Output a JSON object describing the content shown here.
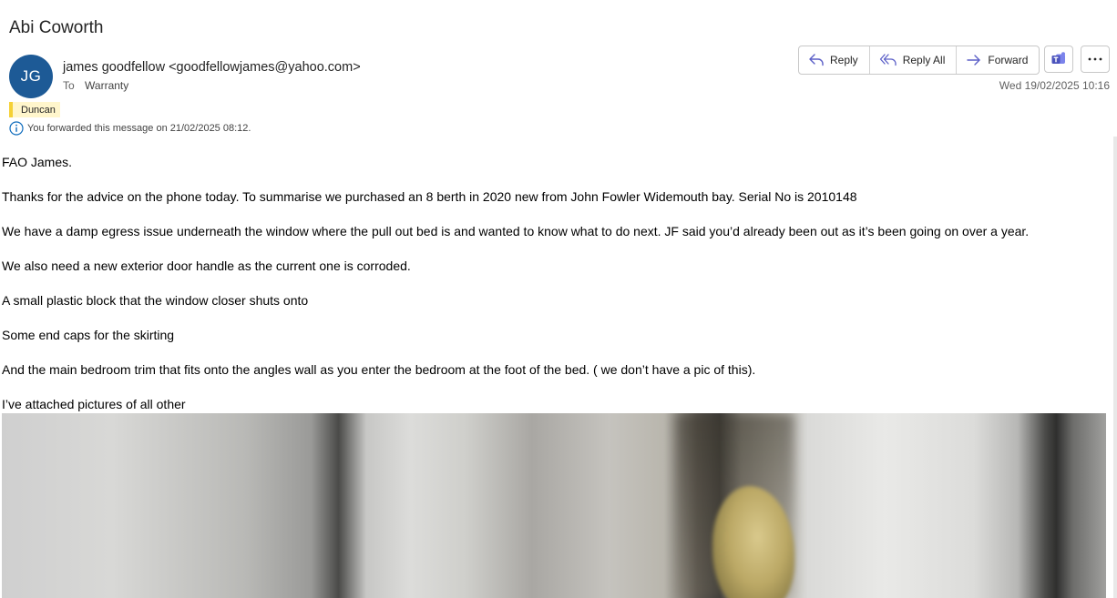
{
  "message": {
    "subject": "Abi Coworth",
    "sender": {
      "initials": "JG",
      "name": "james goodfellow",
      "email": "<goodfellowjames@yahoo.com>"
    },
    "to_label": "To",
    "to": "Warranty",
    "category": "Duncan",
    "info": "You forwarded this message on 21/02/2025 08:12.",
    "date": "Wed 19/02/2025 10:16",
    "body": [
      "FAO James.",
      "Thanks for the advice on the phone today. To summarise we purchased an 8 berth in 2020 new from John Fowler Widemouth bay. Serial No is 2010148",
      "We have a damp egress issue underneath the window where the pull out bed is and wanted to know what to do next. JF said you’d already been out as it’s been going on over a year.",
      "We also need a new exterior door handle as the current one is corroded.",
      "A small plastic block that the window closer shuts onto",
      "Some end caps for the skirting",
      "And the main bedroom trim that fits onto the angles wall as you enter the bedroom at the foot of the bed. ( we don’t have a pic of this).",
      "I’ve attached pictures of all other"
    ]
  },
  "actions": {
    "reply": "Reply",
    "reply_all": "Reply All",
    "forward": "Forward",
    "teams_icon": "teams-icon",
    "more_icon": "more-icon"
  },
  "colors": {
    "avatar": "#1d5a96",
    "category_bar": "#f5d136",
    "category_bg": "#fff6cc",
    "accent": "#5b5fc7",
    "info_icon": "#0f6cbd"
  }
}
